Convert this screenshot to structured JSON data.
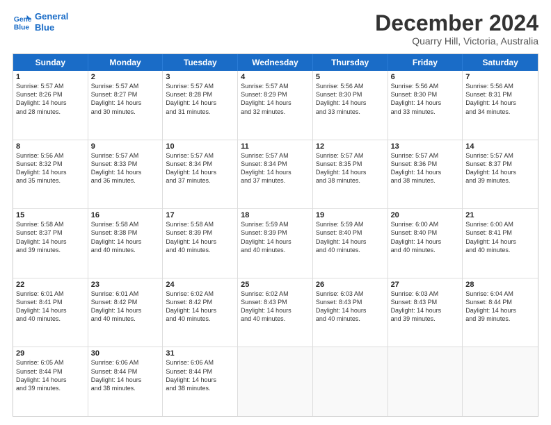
{
  "logo": {
    "line1": "General",
    "line2": "Blue"
  },
  "title": "December 2024",
  "location": "Quarry Hill, Victoria, Australia",
  "header_days": [
    "Sunday",
    "Monday",
    "Tuesday",
    "Wednesday",
    "Thursday",
    "Friday",
    "Saturday"
  ],
  "rows": [
    [
      {
        "day": "1",
        "info": "Sunrise: 5:57 AM\nSunset: 8:26 PM\nDaylight: 14 hours\nand 28 minutes."
      },
      {
        "day": "2",
        "info": "Sunrise: 5:57 AM\nSunset: 8:27 PM\nDaylight: 14 hours\nand 30 minutes."
      },
      {
        "day": "3",
        "info": "Sunrise: 5:57 AM\nSunset: 8:28 PM\nDaylight: 14 hours\nand 31 minutes."
      },
      {
        "day": "4",
        "info": "Sunrise: 5:57 AM\nSunset: 8:29 PM\nDaylight: 14 hours\nand 32 minutes."
      },
      {
        "day": "5",
        "info": "Sunrise: 5:56 AM\nSunset: 8:30 PM\nDaylight: 14 hours\nand 33 minutes."
      },
      {
        "day": "6",
        "info": "Sunrise: 5:56 AM\nSunset: 8:30 PM\nDaylight: 14 hours\nand 33 minutes."
      },
      {
        "day": "7",
        "info": "Sunrise: 5:56 AM\nSunset: 8:31 PM\nDaylight: 14 hours\nand 34 minutes."
      }
    ],
    [
      {
        "day": "8",
        "info": "Sunrise: 5:56 AM\nSunset: 8:32 PM\nDaylight: 14 hours\nand 35 minutes."
      },
      {
        "day": "9",
        "info": "Sunrise: 5:57 AM\nSunset: 8:33 PM\nDaylight: 14 hours\nand 36 minutes."
      },
      {
        "day": "10",
        "info": "Sunrise: 5:57 AM\nSunset: 8:34 PM\nDaylight: 14 hours\nand 37 minutes."
      },
      {
        "day": "11",
        "info": "Sunrise: 5:57 AM\nSunset: 8:34 PM\nDaylight: 14 hours\nand 37 minutes."
      },
      {
        "day": "12",
        "info": "Sunrise: 5:57 AM\nSunset: 8:35 PM\nDaylight: 14 hours\nand 38 minutes."
      },
      {
        "day": "13",
        "info": "Sunrise: 5:57 AM\nSunset: 8:36 PM\nDaylight: 14 hours\nand 38 minutes."
      },
      {
        "day": "14",
        "info": "Sunrise: 5:57 AM\nSunset: 8:37 PM\nDaylight: 14 hours\nand 39 minutes."
      }
    ],
    [
      {
        "day": "15",
        "info": "Sunrise: 5:58 AM\nSunset: 8:37 PM\nDaylight: 14 hours\nand 39 minutes."
      },
      {
        "day": "16",
        "info": "Sunrise: 5:58 AM\nSunset: 8:38 PM\nDaylight: 14 hours\nand 40 minutes."
      },
      {
        "day": "17",
        "info": "Sunrise: 5:58 AM\nSunset: 8:39 PM\nDaylight: 14 hours\nand 40 minutes."
      },
      {
        "day": "18",
        "info": "Sunrise: 5:59 AM\nSunset: 8:39 PM\nDaylight: 14 hours\nand 40 minutes."
      },
      {
        "day": "19",
        "info": "Sunrise: 5:59 AM\nSunset: 8:40 PM\nDaylight: 14 hours\nand 40 minutes."
      },
      {
        "day": "20",
        "info": "Sunrise: 6:00 AM\nSunset: 8:40 PM\nDaylight: 14 hours\nand 40 minutes."
      },
      {
        "day": "21",
        "info": "Sunrise: 6:00 AM\nSunset: 8:41 PM\nDaylight: 14 hours\nand 40 minutes."
      }
    ],
    [
      {
        "day": "22",
        "info": "Sunrise: 6:01 AM\nSunset: 8:41 PM\nDaylight: 14 hours\nand 40 minutes."
      },
      {
        "day": "23",
        "info": "Sunrise: 6:01 AM\nSunset: 8:42 PM\nDaylight: 14 hours\nand 40 minutes."
      },
      {
        "day": "24",
        "info": "Sunrise: 6:02 AM\nSunset: 8:42 PM\nDaylight: 14 hours\nand 40 minutes."
      },
      {
        "day": "25",
        "info": "Sunrise: 6:02 AM\nSunset: 8:43 PM\nDaylight: 14 hours\nand 40 minutes."
      },
      {
        "day": "26",
        "info": "Sunrise: 6:03 AM\nSunset: 8:43 PM\nDaylight: 14 hours\nand 40 minutes."
      },
      {
        "day": "27",
        "info": "Sunrise: 6:03 AM\nSunset: 8:43 PM\nDaylight: 14 hours\nand 39 minutes."
      },
      {
        "day": "28",
        "info": "Sunrise: 6:04 AM\nSunset: 8:44 PM\nDaylight: 14 hours\nand 39 minutes."
      }
    ],
    [
      {
        "day": "29",
        "info": "Sunrise: 6:05 AM\nSunset: 8:44 PM\nDaylight: 14 hours\nand 39 minutes."
      },
      {
        "day": "30",
        "info": "Sunrise: 6:06 AM\nSunset: 8:44 PM\nDaylight: 14 hours\nand 38 minutes."
      },
      {
        "day": "31",
        "info": "Sunrise: 6:06 AM\nSunset: 8:44 PM\nDaylight: 14 hours\nand 38 minutes."
      },
      {
        "day": "",
        "info": ""
      },
      {
        "day": "",
        "info": ""
      },
      {
        "day": "",
        "info": ""
      },
      {
        "day": "",
        "info": ""
      }
    ]
  ]
}
